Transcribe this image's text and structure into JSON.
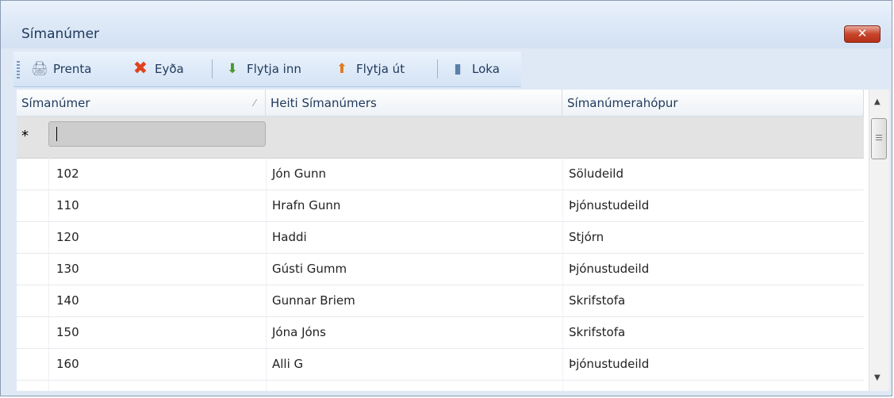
{
  "window": {
    "title": "Símanúmer",
    "close_label": "✕"
  },
  "toolbar": [
    {
      "label": "Prenta",
      "icon": "print-icon"
    },
    {
      "label": "Eyða",
      "icon": "delete-icon"
    },
    {
      "label": "Flytja inn",
      "icon": "import-icon"
    },
    {
      "label": "Flytja út",
      "icon": "export-icon"
    },
    {
      "label": "Loka",
      "icon": "close-door-icon"
    }
  ],
  "grid": {
    "columns": [
      "Símanúmer",
      "Heiti Símanúmers",
      "Símanúmerahópur"
    ],
    "new_row_marker": "*",
    "rows": [
      [
        "102",
        "Jón Gunn",
        "Söludeild"
      ],
      [
        "110",
        "Hrafn Gunn",
        "Þjónustudeild"
      ],
      [
        "120",
        "Haddi",
        "Stjórn"
      ],
      [
        "130",
        "Gústi Gumm",
        "Þjónustudeild"
      ],
      [
        "140",
        "Gunnar Briem",
        "Skrifstofa"
      ],
      [
        "150",
        "Jóna Jóns",
        "Skrifstofa"
      ],
      [
        "160",
        "Alli G",
        "Þjónustudeild"
      ]
    ]
  }
}
